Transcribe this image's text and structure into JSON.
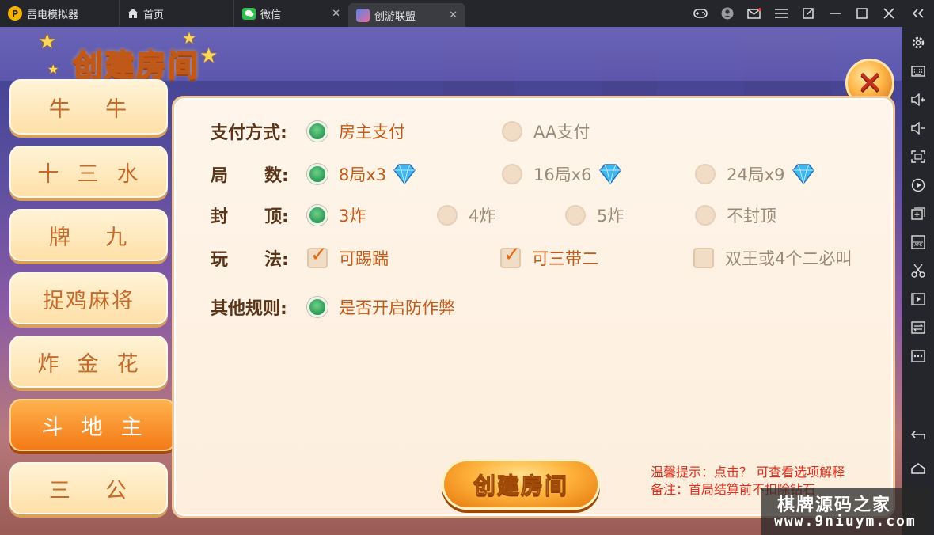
{
  "tabs": [
    {
      "label": "雷电模拟器"
    },
    {
      "label": "首页"
    },
    {
      "label": "微信"
    },
    {
      "label": "创游联盟"
    }
  ],
  "dialog": {
    "title": "创建房间",
    "categories": [
      "牛    牛",
      "十  三  水",
      "牌    九",
      "捉鸡麻将",
      "炸  金  花",
      "斗  地  主",
      "三    公"
    ],
    "selected_category": "斗  地  主"
  },
  "form": {
    "payment": {
      "label": "支付方式:",
      "options": [
        {
          "text": "房主支付",
          "selected": true
        },
        {
          "text": "AA支付",
          "selected": false
        }
      ]
    },
    "rounds": {
      "label": "局      数:",
      "options": [
        {
          "text": "8局x3",
          "selected": true
        },
        {
          "text": "16局x6",
          "selected": false
        },
        {
          "text": "24局x9",
          "selected": false
        }
      ]
    },
    "cap": {
      "label": "封      顶:",
      "options": [
        {
          "text": "3炸",
          "selected": true
        },
        {
          "text": "4炸",
          "selected": false
        },
        {
          "text": "5炸",
          "selected": false
        },
        {
          "text": "不封顶",
          "selected": false
        }
      ]
    },
    "play": {
      "label": "玩      法:",
      "options": [
        {
          "text": "可踢踹",
          "checked": true
        },
        {
          "text": "可三带二",
          "checked": true
        },
        {
          "text": "双王或4个二必叫",
          "checked": false
        }
      ]
    },
    "other": {
      "label": "其他规则:",
      "options": [
        {
          "text": "是否开启防作弊",
          "selected": true
        }
      ]
    }
  },
  "create_button": "创建房间",
  "tips": [
    "温馨提示：点击？ 可查看选项解释",
    "备注：首局结算前不扣除钻石"
  ],
  "watermark": {
    "line1": "棋牌源码之家",
    "line2": "www.9niuym.com"
  },
  "colors": {
    "accent": "#f47a16",
    "selected_radio": "#2f9a55",
    "tip": "#e0301c"
  }
}
